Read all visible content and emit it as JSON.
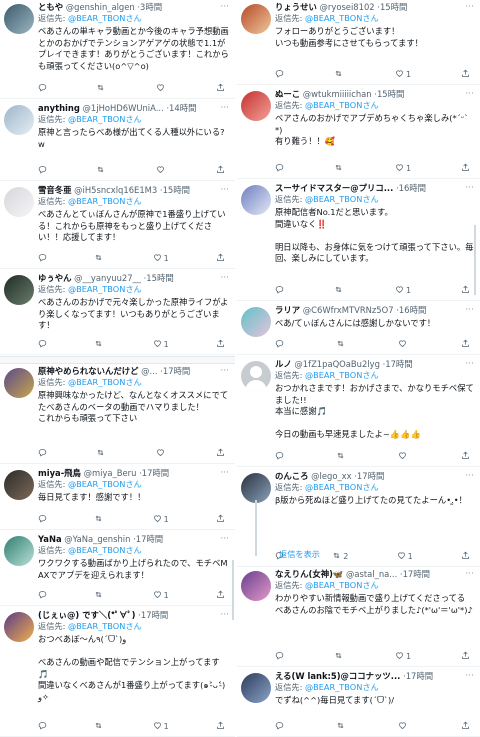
{
  "reply_prefix": "返信先:",
  "show_replies": "返信を表示",
  "left": [
    {
      "name": "ともや",
      "handle": "@genshin_algen",
      "time": "3時間",
      "reply_to": "@BEAR_TBONさん",
      "text": "ベあさんの単キャラ動画とか今後のキャラ予想動画とかのおかげでテンションアゲアゲの状態で1.1がプレイできます！ありがとうございます！これからも頑張ってください(o^▽^o)",
      "likes": "",
      "retweets": ""
    },
    {
      "name": "anything",
      "handle": "@1jHoHD6WUniA...",
      "time": "14時間",
      "reply_to": "@BEAR_TBONさん",
      "text": "原神と言ったらべあ様が出てくる人種以外にいる?w",
      "likes": "",
      "retweets": ""
    },
    {
      "name": "雪音冬亜",
      "handle": "@iH5sncxlq16E1M3",
      "time": "15時間",
      "reply_to": "@BEAR_TBONさん",
      "text": "べあさんとてぃぼんさんが原神で1番盛り上げている！これからも原神をもっと盛り上げてください！！応援してます！",
      "likes": "1",
      "retweets": ""
    },
    {
      "name": "ゆぅやん",
      "handle": "@__yanyuu27__",
      "time": "15時間",
      "reply_to": "@BEAR_TBONさん",
      "text": "べあさんのおかげで元々楽しかった原神ライフがより楽しくなってます！いつもありがとうございます！",
      "likes": "1",
      "retweets": ""
    },
    {
      "name": "原神やめられないんだけど",
      "handle": "@...",
      "time": "17時間",
      "reply_to": "@BEAR_TBONさん",
      "text": "原神興味なかったけど、なんとなくオススメにでてたべあさんのベータの動画でハマりました！\nこれからも頑張って下さい",
      "likes": "",
      "retweets": ""
    },
    {
      "name": "miya-飛鳥",
      "handle": "@miya_Beru",
      "time": "17時間",
      "reply_to": "@BEAR_TBONさん",
      "text": "毎日見てます！感謝です！！",
      "likes": "1",
      "retweets": ""
    },
    {
      "name": "YaNa",
      "handle": "@YaNa_genshin",
      "time": "17時間",
      "reply_to": "@BEAR_TBONさん",
      "text": "ワクワクする動画ばかり上げられたので、モチベMAXでアプデを迎えられます！",
      "likes": "1",
      "retweets": ""
    },
    {
      "name": "(じぇぃ@) です＼(*ﾟ∀ﾟ)",
      "handle": "",
      "time": "17時間",
      "reply_to": "@BEAR_TBONさん",
      "text": "おつべあぼ〜ん٩(ˊᗜˋ)و\n\nべあさんの動画や配信でテンション上がってます🎵\n間違いなくべあさんが1番盛り上がってます(๑˃̵ᴗ˂̵)و✧",
      "likes": "1",
      "retweets": ""
    }
  ],
  "right": [
    {
      "name": "りょうせい",
      "handle": "@ryosei8102",
      "time": "15時間",
      "reply_to": "@BEAR_TBONさん",
      "text": "フォローありがとうございます！\nいつも動画参考にさせてもらってます！",
      "likes": "1",
      "retweets": ""
    },
    {
      "name": "ぬーこ",
      "handle": "@wtukmiiiiichan",
      "time": "15時間",
      "reply_to": "@BEAR_TBONさん",
      "text": "ベアさんのおかげでアプデめちゃくちゃ楽しみ(*ˊᵕˋ*)\n有り難う！！🥰",
      "likes": "1",
      "retweets": ""
    },
    {
      "name": "スーサイドマスター@プリコ...",
      "handle": "",
      "time": "16時間",
      "reply_to": "@BEAR_TBONさん",
      "text": "原神配信者No.1だと思います。\n間違いなく‼️\n\n明日以降も、お身体に気をつけて頑張って下さい。毎回、楽しみにしています。",
      "likes": "1",
      "retweets": ""
    },
    {
      "name": "ラリア",
      "handle": "@C6WfrxMTVRNz5O7",
      "time": "16時間",
      "reply_to": "",
      "text": "べあ/てぃぼんさんには感謝しかないです！",
      "likes": "",
      "retweets": ""
    },
    {
      "name": "ルノ",
      "handle": "@1fZ1paQOaBu2lyg",
      "time": "17時間",
      "reply_to": "@BEAR_TBONさん",
      "text": "おつかれさまです！おかげさまで、かなりモチベ保てました!!\n本当に感謝🎵\n\n今日の動画も早速見ましたよ~👍👍👍",
      "likes": "",
      "retweets": ""
    },
    {
      "name": "のんころ",
      "handle": "@lego_xx",
      "time": "17時間",
      "reply_to": "@BEAR_TBONさん",
      "text": "β版から死ぬほど盛り上げてたの見てたよーん•.̫•！",
      "likes": "1",
      "retweets": "2"
    },
    {
      "name": "なえりん(女神)🦋",
      "handle": "@astal_na...",
      "time": "17時間",
      "reply_to": "@BEAR_TBONさん",
      "text": "わかりやすい新情報動画で盛り上げてくださってる\nべあさんのお陰でモチベ上がりました♪(*'ω'＝'ω'*)♪",
      "likes": "1",
      "retweets": ""
    },
    {
      "name": "える(W lank:5)@ココナッツ...",
      "handle": "",
      "time": "17時間",
      "reply_to": "@BEAR_TBONさん",
      "text": "でずね(^^)毎日見てます(ˊᗜˋ)/",
      "likes": "",
      "retweets": ""
    }
  ],
  "icons": {
    "reply": "reply-icon",
    "retweet": "retweet-icon",
    "like": "heart-icon",
    "share": "share-icon",
    "more": "more-icon"
  },
  "colors": {
    "accent": "#1d9bf0",
    "text": "#0f1419",
    "muted": "#536471",
    "border": "#eff3f4"
  }
}
